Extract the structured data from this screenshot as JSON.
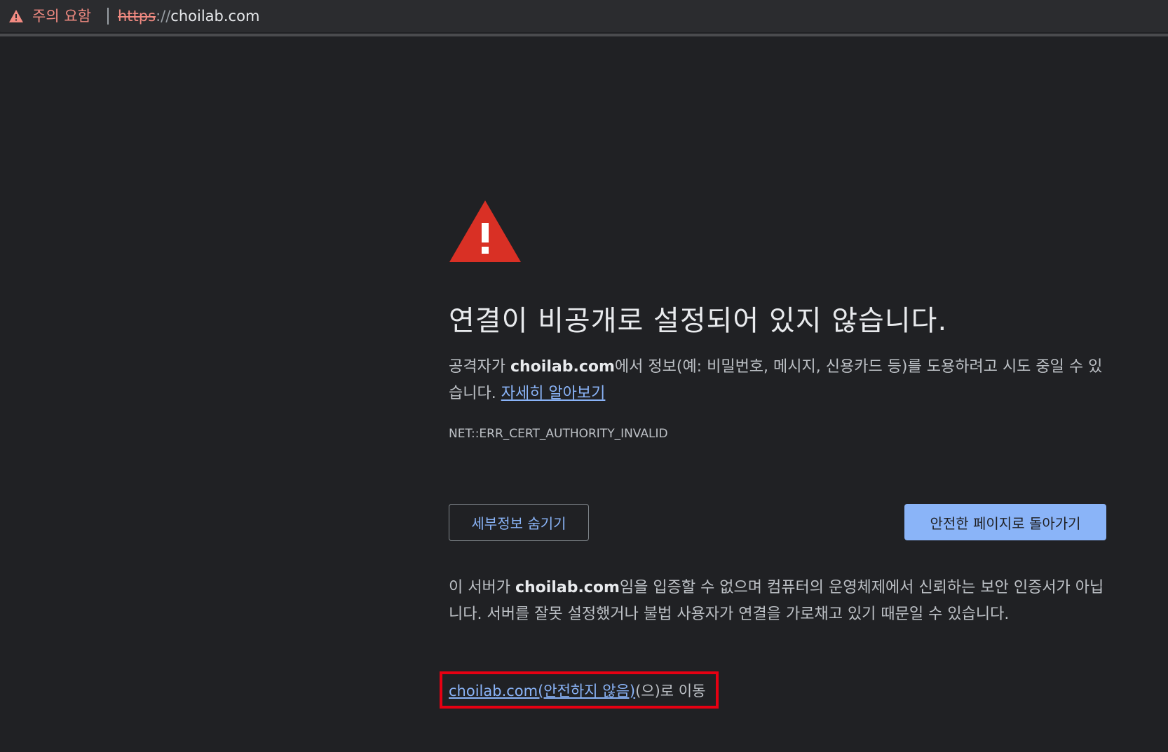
{
  "omnibox": {
    "security_label": "주의 요함",
    "url_scheme": "https",
    "url_slashes": "://",
    "url_host": "choilab.com"
  },
  "interstitial": {
    "heading": "연결이 비공개로 설정되어 있지 않습니다.",
    "explanation_prefix": "공격자가 ",
    "explanation_host": "choilab.com",
    "explanation_suffix": "에서 정보(예: 비밀번호, 메시지, 신용카드 등)를 도용하려고 시도 중일 수 있습니다. ",
    "learn_more": "자세히 알아보기",
    "error_code": "NET::ERR_CERT_AUTHORITY_INVALID",
    "details_button": "세부정보 숨기기",
    "back_button": "안전한 페이지로 돌아가기",
    "details_prefix": "이 서버가 ",
    "details_host": "choilab.com",
    "details_suffix": "임을 입증할 수 없으며 컴퓨터의 운영체제에서 신뢰하는 보안 인증서가 아닙니다. 서버를 잘못 설정했거나 불법 사용자가 연결을 가로채고 있기 때문일 수 있습니다.",
    "proceed_link": "choilab.com(안전하지 않음)",
    "proceed_suffix": "(으)로 이동"
  },
  "colors": {
    "background": "#202124",
    "warning_red": "#d93025",
    "link_blue": "#8ab4f8",
    "highlight_box": "#e60012"
  }
}
